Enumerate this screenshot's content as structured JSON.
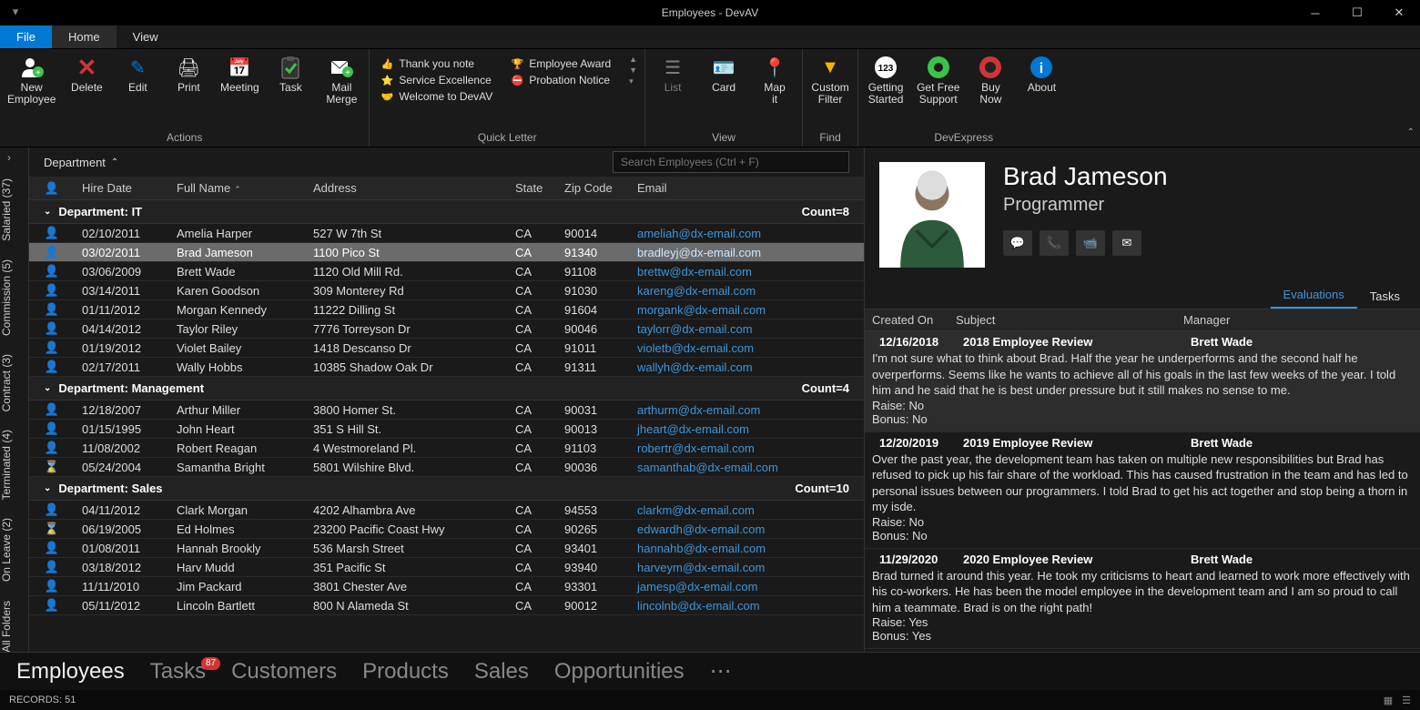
{
  "window": {
    "title": "Employees - DevAV"
  },
  "menu": {
    "file": "File",
    "home": "Home",
    "view": "View"
  },
  "ribbon": {
    "actions": {
      "label": "Actions",
      "new": "New\nEmployee",
      "delete": "Delete",
      "edit": "Edit",
      "print": "Print",
      "meeting": "Meeting",
      "task": "Task",
      "mail": "Mail\nMerge"
    },
    "quick": {
      "label": "Quick Letter",
      "items": [
        "Thank you note",
        "Employee Award",
        "Service Excellence",
        "Probation Notice",
        "Welcome to DevAV"
      ]
    },
    "view": {
      "label": "View",
      "list": "List",
      "card": "Card",
      "map": "Map\nit"
    },
    "find": {
      "label": "Find",
      "filter": "Custom\nFilter"
    },
    "dx": {
      "label": "DevExpress",
      "start": "Getting\nStarted",
      "support": "Get Free\nSupport",
      "buy": "Buy\nNow",
      "about": "About"
    }
  },
  "sidenav": [
    "Salaried (37)",
    "Commission (5)",
    "Contract (3)",
    "Terminated (4)",
    "On Leave (2)",
    "All Folders"
  ],
  "grid": {
    "groupby": "Department",
    "search_placeholder": "Search Employees (Ctrl + F)",
    "columns": {
      "hire": "Hire Date",
      "name": "Full Name",
      "addr": "Address",
      "state": "State",
      "zip": "Zip Code",
      "email": "Email"
    },
    "groups": [
      {
        "title": "Department: IT",
        "count": "Count=8",
        "rows": [
          {
            "ic": "blue",
            "hire": "02/10/2011",
            "name": "Amelia Harper",
            "addr": "527 W 7th St",
            "st": "CA",
            "zip": "90014",
            "email": "ameliah@dx-email.com"
          },
          {
            "ic": "blue",
            "hire": "03/02/2011",
            "name": "Brad Jameson",
            "addr": "1100 Pico St",
            "st": "CA",
            "zip": "91340",
            "email": "bradleyj@dx-email.com",
            "sel": true
          },
          {
            "ic": "blue",
            "hire": "03/06/2009",
            "name": "Brett Wade",
            "addr": "1120 Old Mill Rd.",
            "st": "CA",
            "zip": "91108",
            "email": "brettw@dx-email.com"
          },
          {
            "ic": "green",
            "hire": "03/14/2011",
            "name": "Karen Goodson",
            "addr": "309 Monterey Rd",
            "st": "CA",
            "zip": "91030",
            "email": "kareng@dx-email.com"
          },
          {
            "ic": "blue",
            "hire": "01/11/2012",
            "name": "Morgan Kennedy",
            "addr": "11222 Dilling St",
            "st": "CA",
            "zip": "91604",
            "email": "morgank@dx-email.com"
          },
          {
            "ic": "white",
            "hire": "04/14/2012",
            "name": "Taylor Riley",
            "addr": "7776 Torreyson Dr",
            "st": "CA",
            "zip": "90046",
            "email": "taylorr@dx-email.com"
          },
          {
            "ic": "white",
            "hire": "01/19/2012",
            "name": "Violet Bailey",
            "addr": "1418 Descanso Dr",
            "st": "CA",
            "zip": "91011",
            "email": "violetb@dx-email.com"
          },
          {
            "ic": "blue",
            "hire": "02/17/2011",
            "name": "Wally Hobbs",
            "addr": "10385 Shadow Oak Dr",
            "st": "CA",
            "zip": "91311",
            "email": "wallyh@dx-email.com"
          }
        ]
      },
      {
        "title": "Department: Management",
        "count": "Count=4",
        "rows": [
          {
            "ic": "blue",
            "hire": "12/18/2007",
            "name": "Arthur Miller",
            "addr": "3800 Homer St.",
            "st": "CA",
            "zip": "90031",
            "email": "arthurm@dx-email.com"
          },
          {
            "ic": "blue",
            "hire": "01/15/1995",
            "name": "John Heart",
            "addr": "351 S Hill St.",
            "st": "CA",
            "zip": "90013",
            "email": "jheart@dx-email.com"
          },
          {
            "ic": "blue",
            "hire": "11/08/2002",
            "name": "Robert Reagan",
            "addr": "4 Westmoreland Pl.",
            "st": "CA",
            "zip": "91103",
            "email": "robertr@dx-email.com"
          },
          {
            "ic": "grey",
            "hire": "05/24/2004",
            "name": "Samantha Bright",
            "addr": "5801 Wilshire Blvd.",
            "st": "CA",
            "zip": "90036",
            "email": "samanthab@dx-email.com"
          }
        ]
      },
      {
        "title": "Department: Sales",
        "count": "Count=10",
        "rows": [
          {
            "ic": "blue",
            "hire": "04/11/2012",
            "name": "Clark Morgan",
            "addr": "4202 Alhambra Ave",
            "st": "CA",
            "zip": "94553",
            "email": "clarkm@dx-email.com"
          },
          {
            "ic": "grey",
            "hire": "06/19/2005",
            "name": "Ed Holmes",
            "addr": "23200 Pacific Coast Hwy",
            "st": "CA",
            "zip": "90265",
            "email": "edwardh@dx-email.com"
          },
          {
            "ic": "blue",
            "hire": "01/08/2011",
            "name": "Hannah Brookly",
            "addr": "536 Marsh Street",
            "st": "CA",
            "zip": "93401",
            "email": "hannahb@dx-email.com"
          },
          {
            "ic": "blue",
            "hire": "03/18/2012",
            "name": "Harv Mudd",
            "addr": "351 Pacific St",
            "st": "CA",
            "zip": "93940",
            "email": "harveym@dx-email.com"
          },
          {
            "ic": "blue",
            "hire": "11/11/2010",
            "name": "Jim Packard",
            "addr": "3801 Chester Ave",
            "st": "CA",
            "zip": "93301",
            "email": "jamesp@dx-email.com"
          },
          {
            "ic": "blue",
            "hire": "05/11/2012",
            "name": "Lincoln Bartlett",
            "addr": "800 N Alameda St",
            "st": "CA",
            "zip": "90012",
            "email": "lincolnb@dx-email.com"
          }
        ]
      }
    ]
  },
  "detail": {
    "name": "Brad Jameson",
    "role": "Programmer",
    "tabs": {
      "eval": "Evaluations",
      "tasks": "Tasks"
    },
    "eval_cols": {
      "date": "Created On",
      "subj": "Subject",
      "mgr": "Manager"
    },
    "evals": [
      {
        "date": "12/16/2018",
        "subj": "2018 Employee Review",
        "mgr": "Brett Wade",
        "sel": true,
        "body": "I'm not sure what to think about Brad. Half the year he underperforms and the second half he overperforms. Seems like he wants to achieve all of his goals in the last few weeks of the year. I told him and he said that he is best under pressure but it still makes no sense to me.",
        "raise": "Raise: No",
        "bonus": "Bonus: No"
      },
      {
        "date": "12/20/2019",
        "subj": "2019 Employee Review",
        "mgr": "Brett Wade",
        "body": "Over the past year, the development team has taken on multiple new responsibilities but Brad has refused to pick up his fair share of the workload. This has caused frustration in the team and has led to personal issues between our programmers. I told Brad to get his act together and stop being a thorn in my isde.",
        "raise": "Raise: No",
        "bonus": "Bonus: No"
      },
      {
        "date": "11/29/2020",
        "subj": "2020 Employee Review",
        "mgr": "Brett Wade",
        "body": "Brad turned it around this year. He took my criticisms to heart and learned to work more effectively with his co-workers. He has been the model employee in the development team and I am so proud to call him a teammate. Brad is on the right path!",
        "raise": "Raise: Yes",
        "bonus": "Bonus: Yes"
      }
    ]
  },
  "bottom": {
    "employees": "Employees",
    "tasks": "Tasks",
    "badge": "87",
    "customers": "Customers",
    "products": "Products",
    "sales": "Sales",
    "opps": "Opportunities"
  },
  "status": {
    "records": "RECORDS: 51"
  }
}
